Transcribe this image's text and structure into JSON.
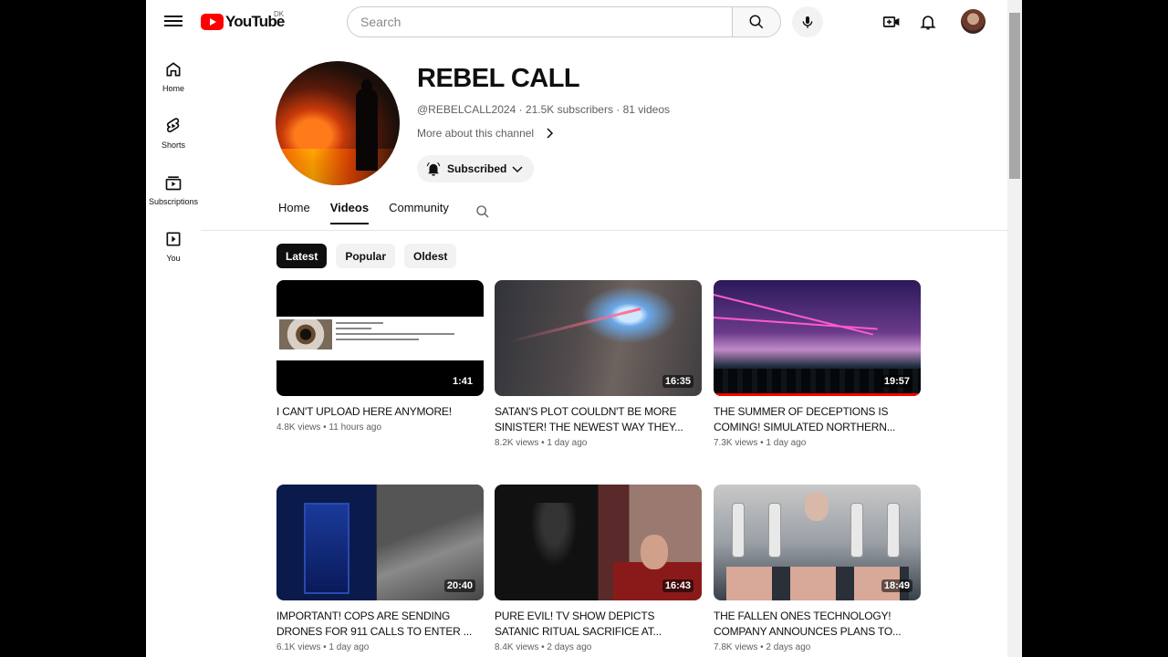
{
  "header": {
    "logo_text": "YouTube",
    "country_code": "DK",
    "search_placeholder": "Search"
  },
  "sidebar": {
    "items": [
      {
        "label": "Home",
        "icon": "home-icon"
      },
      {
        "label": "Shorts",
        "icon": "shorts-icon"
      },
      {
        "label": "Subscriptions",
        "icon": "subscriptions-icon"
      },
      {
        "label": "You",
        "icon": "you-icon"
      }
    ]
  },
  "channel": {
    "name": "REBEL CALL",
    "meta": "@REBELCALL2024 · 21.5K subscribers · 81 videos",
    "more_about": "More about this channel",
    "subscribe_label": "Subscribed"
  },
  "tabs": [
    "Home",
    "Videos",
    "Community"
  ],
  "active_tab": "Videos",
  "chips": [
    "Latest",
    "Popular",
    "Oldest"
  ],
  "videos": [
    {
      "title": "I CAN'T UPLOAD HERE ANYMORE!",
      "meta": "4.8K views • 11 hours ago",
      "duration": "1:41"
    },
    {
      "title": "SATAN'S PLOT COULDN'T BE MORE SINISTER! THE NEWEST WAY THEY...",
      "meta": "8.2K views • 1 day ago",
      "duration": "16:35"
    },
    {
      "title": "THE SUMMER OF DECEPTIONS IS COMING! SIMULATED NORTHERN...",
      "meta": "7.3K views • 1 day ago",
      "duration": "19:57"
    },
    {
      "title": "IMPORTANT! COPS ARE SENDING DRONES FOR 911 CALLS TO ENTER ...",
      "meta": "6.1K views • 1 day ago",
      "duration": "20:40"
    },
    {
      "title": "PURE EVIL! TV SHOW DEPICTS SATANIC RITUAL SACRIFICE AT...",
      "meta": "8.4K views • 2 days ago",
      "duration": "16:43"
    },
    {
      "title": "THE FALLEN ONES TECHNOLOGY! COMPANY ANNOUNCES PLANS TO...",
      "meta": "7.8K views • 2 days ago",
      "duration": "18:49"
    }
  ],
  "colors": {
    "brand": "#ff0000",
    "chip_active": "#0f0f0f"
  }
}
